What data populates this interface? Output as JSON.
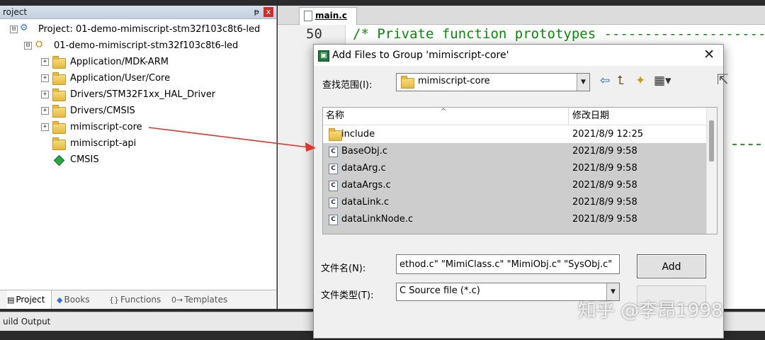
{
  "project_panel": {
    "title": "roject",
    "pin_glyph": "ᵽ",
    "close_glyph": "x",
    "tree": [
      {
        "label": "Project: 01-demo-mimiscript-stm32f103c8t6-led",
        "expander": "⊟",
        "icon": "project-icon"
      },
      {
        "label": "01-demo-mimiscript-stm32f103c8t6-led",
        "expander": "⊟",
        "icon": "target-icon"
      },
      {
        "label": "Application/MDK-ARM",
        "expander": "+",
        "icon": "folder-icon"
      },
      {
        "label": "Application/User/Core",
        "expander": "+",
        "icon": "folder-icon"
      },
      {
        "label": "Drivers/STM32F1xx_HAL_Driver",
        "expander": "+",
        "icon": "folder-icon"
      },
      {
        "label": "Drivers/CMSIS",
        "expander": "+",
        "icon": "folder-icon"
      },
      {
        "label": "mimiscript-core",
        "expander": "+",
        "icon": "folder-icon"
      },
      {
        "label": "mimiscript-api",
        "expander": "",
        "icon": "folder-icon"
      },
      {
        "label": "CMSIS",
        "expander": "",
        "icon": "diamond-icon"
      }
    ],
    "tabs": [
      {
        "label": "Project",
        "glyph": "▤"
      },
      {
        "label": "Books",
        "glyph": "◆"
      },
      {
        "label": "Functions",
        "glyph": "{}"
      },
      {
        "label": "Templates",
        "glyph": "0→"
      }
    ]
  },
  "build_output": {
    "label": "uild Output"
  },
  "editor": {
    "tab_label": "main.c",
    "line_number": "50",
    "code_text": "/* Private function prototypes --------------------"
  },
  "dialog": {
    "title": "Add Files to Group 'mimiscript-core'",
    "close_glyph": "✕",
    "look_in_label": "查找范围(I):",
    "look_in_value": "mimiscript-core",
    "combo_arrow": "▼",
    "columns": {
      "name": "名称",
      "date": "修改日期"
    },
    "sort_glyph": "^",
    "files": [
      {
        "name": "include",
        "date": "2021/8/9 12:25",
        "type": "folder",
        "selected": false
      },
      {
        "name": "BaseObj.c",
        "date": "2021/8/9 9:58",
        "type": "c",
        "selected": true
      },
      {
        "name": "dataArg.c",
        "date": "2021/8/9 9:58",
        "type": "c",
        "selected": true
      },
      {
        "name": "dataArgs.c",
        "date": "2021/8/9 9:58",
        "type": "c",
        "selected": true
      },
      {
        "name": "dataLink.c",
        "date": "2021/8/9 9:58",
        "type": "c",
        "selected": true
      },
      {
        "name": "dataLinkNode.c",
        "date": "2021/8/9 9:58",
        "type": "c",
        "selected": true
      }
    ],
    "file_name_label": "文件名(N):",
    "file_name_value": "ethod.c\" \"MimiClass.c\" \"MimiObj.c\" \"SysObj.c\"",
    "file_type_label": "文件类型(T):",
    "file_type_value": "C Source file (*.c)",
    "add_button": "Add",
    "toolbar_glyphs": {
      "back": "⇦",
      "up": "⮤",
      "new_folder": "✦",
      "view": "▦▾"
    }
  },
  "watermark": "知乎 @李昂1998",
  "colors": {
    "arrow": "#e0342c",
    "selection": "#cdcdcd",
    "code_comment": "#0a8a0a"
  }
}
